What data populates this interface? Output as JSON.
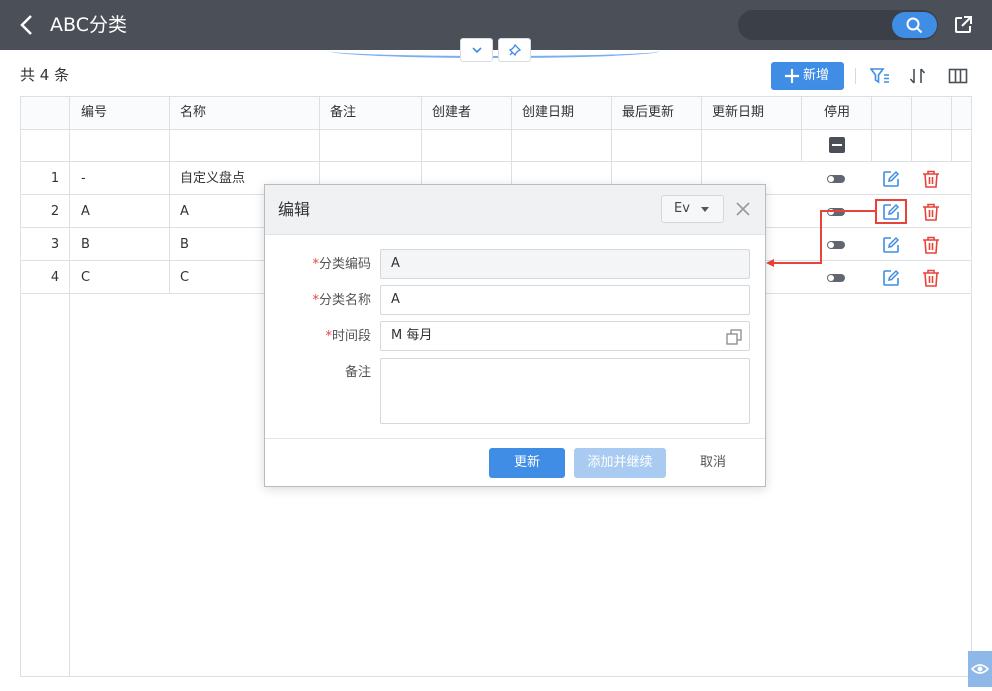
{
  "header": {
    "title": "ABC分类",
    "search_placeholder": ""
  },
  "toolbar": {
    "count_text": "共 4 条",
    "add_label": "新增"
  },
  "table": {
    "columns": [
      "编号",
      "名称",
      "备注",
      "创建者",
      "创建日期",
      "最后更新",
      "更新日期",
      "停用"
    ],
    "rows": [
      {
        "num": "1",
        "code": "-",
        "name": "自定义盘点"
      },
      {
        "num": "2",
        "code": "A",
        "name": "A"
      },
      {
        "num": "3",
        "code": "B",
        "name": "B"
      },
      {
        "num": "4",
        "code": "C",
        "name": "C"
      }
    ]
  },
  "dialog": {
    "title": "编辑",
    "lang": "Ev",
    "fields": {
      "code_label": "分类编码",
      "code_value": "A",
      "name_label": "分类名称",
      "name_value": "A",
      "period_label": "时间段",
      "period_value": "M 每月",
      "remark_label": "备注",
      "remark_value": ""
    },
    "required_mark": "*",
    "update_label": "更新",
    "add_continue_label": "添加并继续",
    "cancel_label": "取消"
  },
  "colors": {
    "primary": "#3f8de4",
    "topbar": "#4a4f58",
    "danger": "#e8433a",
    "disabled": "#a9cbf1"
  }
}
